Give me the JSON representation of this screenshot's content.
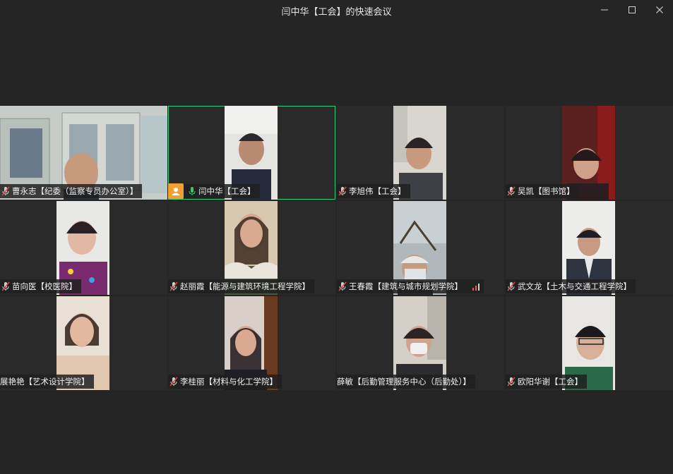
{
  "window": {
    "title": "闫中华【工会】的快速会议"
  },
  "colors": {
    "background": "#252526",
    "active_border": "#2fcf7b",
    "host_badge": "#f0a030",
    "mic_muted": "#e04848",
    "mic_active": "#3fc26a"
  },
  "participants": [
    {
      "name": "曹永志【纪委（监察专员办公室）】",
      "mic": "muted"
    },
    {
      "name": "闫中华【工会】",
      "mic": "active",
      "host": true
    },
    {
      "name": "李旭伟【工会】",
      "mic": "muted"
    },
    {
      "name": "吴凯【图书馆】",
      "mic": "muted"
    },
    {
      "name": "苗向医【校医院】",
      "mic": "muted"
    },
    {
      "name": "赵丽霞【能源与建筑环境工程学院】",
      "mic": "muted"
    },
    {
      "name": "王春霞【建筑与城市规划学院】",
      "mic": "muted",
      "signal": "weak"
    },
    {
      "name": "武文龙【土木与交通工程学院】",
      "mic": "muted"
    },
    {
      "name": "展艳艳【艺术设计学院】",
      "mic": "none"
    },
    {
      "name": "李桂丽【材料与化工学院】",
      "mic": "muted"
    },
    {
      "name": "薛敏【后勤管理服务中心（后勤处）】",
      "mic": "none"
    },
    {
      "name": "欧阳华谢【工会】",
      "mic": "muted"
    }
  ]
}
